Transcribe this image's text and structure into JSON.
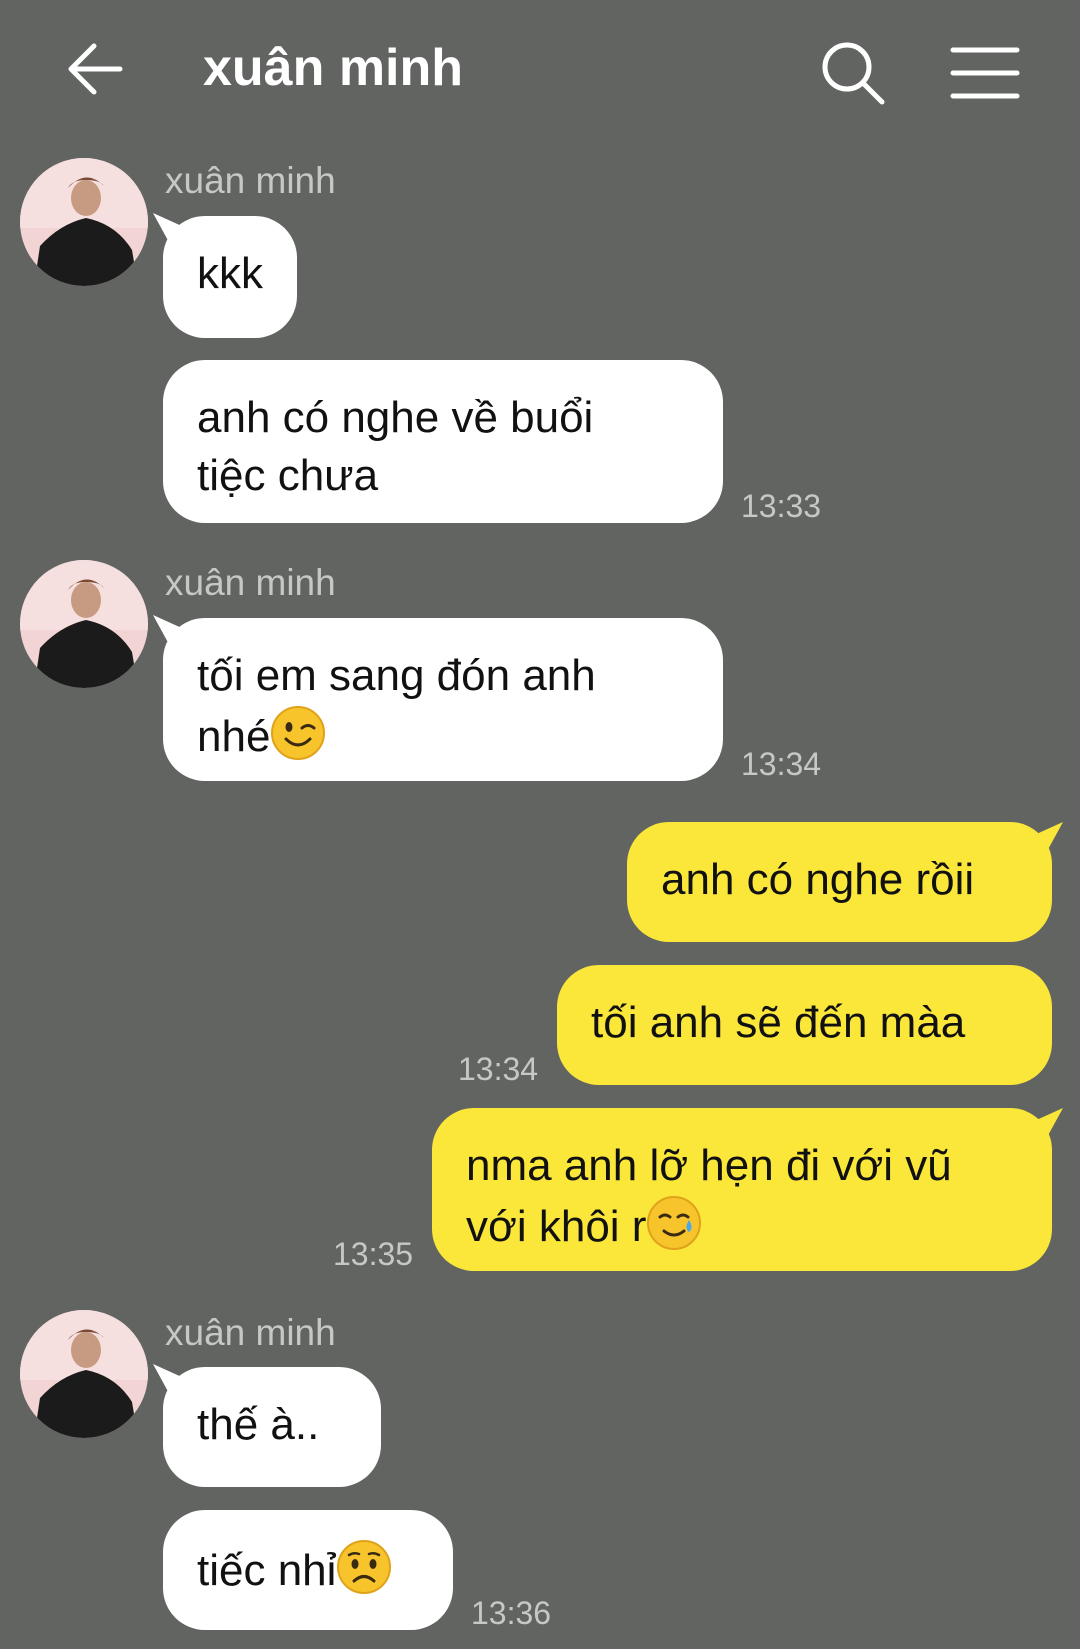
{
  "header": {
    "title": "xuân minh",
    "back_icon": "arrow-left-icon",
    "search_icon": "search-icon",
    "menu_icon": "hamburger-menu-icon"
  },
  "colors": {
    "background": "#626462",
    "incoming_bubble": "#ffffff",
    "outgoing_bubble": "#fbe73a"
  },
  "messages": [
    {
      "sender": "xuân minh",
      "text": "kkk",
      "time": ""
    },
    {
      "sender": "xuân minh",
      "lines": [
        "anh có nghe về buổi",
        "tiệc chưa"
      ],
      "time": "13:33"
    },
    {
      "sender": "xuân minh",
      "lines": [
        "tối em sang đón anh",
        "nhé"
      ],
      "emoji": "winking-face-emoji",
      "time": "13:34"
    },
    {
      "sender": "me",
      "text": "anh có nghe rồii",
      "time": ""
    },
    {
      "sender": "me",
      "text": "tối anh sẽ đến màa",
      "time": "13:34"
    },
    {
      "sender": "me",
      "lines": [
        "nma anh lỡ hẹn đi với vũ",
        "với khôi r"
      ],
      "emoji": "smiling-face-with-tear-emoji",
      "time": "13:35"
    },
    {
      "sender": "xuân minh",
      "text": "thế à..",
      "time": ""
    },
    {
      "sender": "xuân minh",
      "text": "tiếc nhỉ",
      "emoji": "worried-face-emoji",
      "time": "13:36"
    }
  ]
}
